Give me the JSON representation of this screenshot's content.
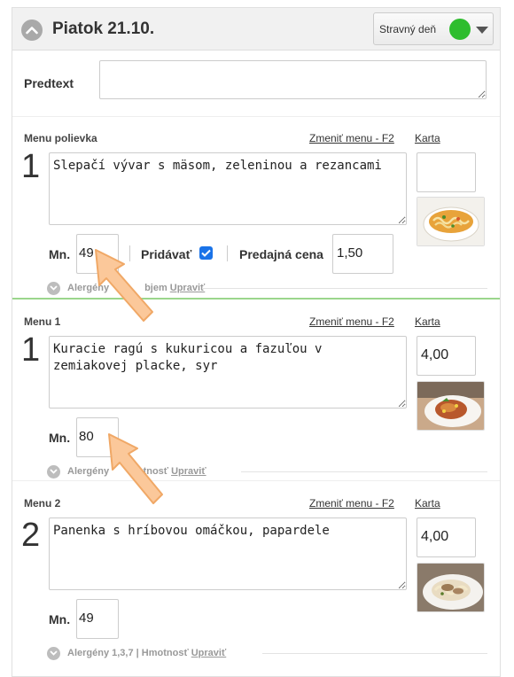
{
  "header": {
    "title": "Piatok 21.10.",
    "day_type_label": "Stravný deň",
    "status_color": "#2ebd2e"
  },
  "predtext": {
    "label": "Predtext",
    "value": ""
  },
  "sections": [
    {
      "label": "Menu polievka",
      "change_link": "Zmeniť menu - F2",
      "card_link": "Karta",
      "number": "1",
      "meal_text": "Slepačí vývar s mäsom, zeleninou a rezancami",
      "price": "",
      "photo_icon": "soup-photo",
      "qty_label": "Mn.",
      "qty": "49",
      "add_label": "Pridávať",
      "add_checked": true,
      "sale_price_label": "Predajná cena",
      "sale_price": "1,50",
      "allergens_text": "Alergény",
      "allergens_tail": "bjem",
      "edit_link": "Upraviť"
    },
    {
      "label": "Menu 1",
      "change_link": "Zmeniť menu - F2",
      "card_link": "Karta",
      "number": "1",
      "meal_text": "Kuracie ragú s kukuricou a fazuľou v zemiakovej placke, syr",
      "price": "4,00",
      "photo_icon": "chicken-dish-photo",
      "qty_label": "Mn.",
      "qty": "80",
      "allergens_text": "Alergény",
      "allergens_tail": "motnosť",
      "edit_link": "Upraviť"
    },
    {
      "label": "Menu 2",
      "change_link": "Zmeniť menu - F2",
      "card_link": "Karta",
      "number": "2",
      "meal_text": "Panenka s hríbovou omáčkou, papardele",
      "price": "4,00",
      "photo_icon": "pork-pasta-photo",
      "qty_label": "Mn.",
      "qty": "49",
      "allergens_text": "Alergény 1,3,7 | Hmotnosť",
      "edit_link": "Upraviť"
    }
  ],
  "annotations": {
    "arrow_color": "#f7b27a"
  }
}
